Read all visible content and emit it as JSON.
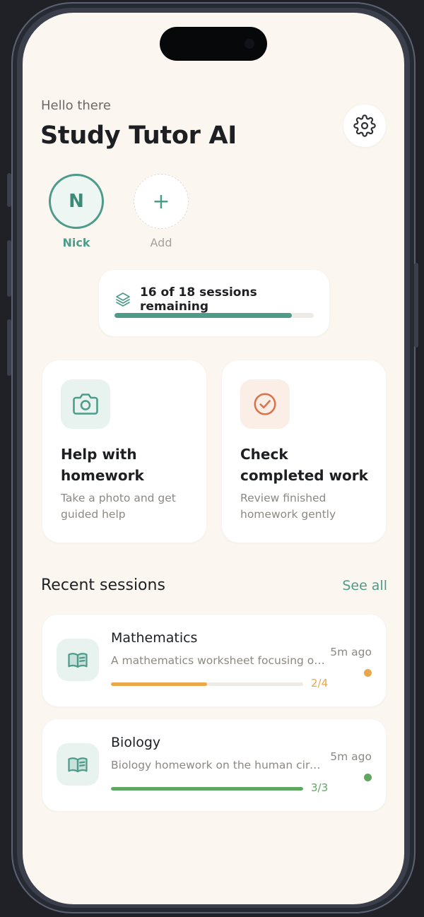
{
  "header": {
    "greeting": "Hello there",
    "title": "Study Tutor AI",
    "settings_icon": "gear-icon"
  },
  "profiles": [
    {
      "initial": "N",
      "label": "Nick",
      "active": true
    },
    {
      "initial": "+",
      "label": "Add",
      "active": false
    }
  ],
  "sessions_remaining": {
    "text": "16 of 18 sessions remaining",
    "used": 16,
    "total": 18,
    "icon": "layers-icon"
  },
  "actions": [
    {
      "title": "Help with homework",
      "description": "Take a photo and get guided help",
      "icon": "camera-icon",
      "icon_color": "#4e9b8a",
      "icon_bg": "#e8f3ef"
    },
    {
      "title": "Check completed work",
      "description": "Review finished homework gently",
      "icon": "check-circle-icon",
      "icon_color": "#d9744a",
      "icon_bg": "#fbeee6"
    }
  ],
  "recent": {
    "title": "Recent sessions",
    "see_all": "See all",
    "items": [
      {
        "subject": "Mathematics",
        "description": "A mathematics worksheet focusing on fractions and decimals",
        "progress_label": "2/4",
        "done": 2,
        "total": 4,
        "time": "5m ago",
        "color": "#eba84a",
        "icon": "book-icon"
      },
      {
        "subject": "Biology",
        "description": "Biology homework on the human circulatory system",
        "progress_label": "3/3",
        "done": 3,
        "total": 3,
        "time": "5m ago",
        "color": "#5fa75f",
        "icon": "book-icon"
      }
    ]
  },
  "colors": {
    "accent": "#4e9b8a",
    "background": "#fbf7f0",
    "card": "#ffffff"
  }
}
